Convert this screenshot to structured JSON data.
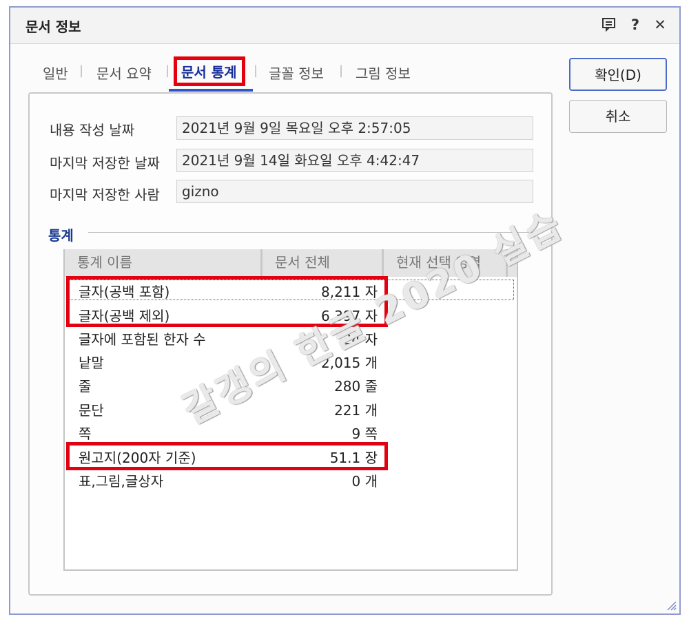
{
  "window": {
    "title": "문서 정보"
  },
  "titlebar_icons": [
    "comment-icon",
    "help-icon",
    "close-icon"
  ],
  "titlebar_glyphs": {
    "help": "?",
    "close": "✕"
  },
  "tabs": [
    {
      "label": "일반",
      "active": false
    },
    {
      "label": "문서 요약",
      "active": false
    },
    {
      "label": "문서 통계",
      "active": true
    },
    {
      "label": "글꼴 정보",
      "active": false
    },
    {
      "label": "그림 정보",
      "active": false
    }
  ],
  "separator": "|",
  "fields": [
    {
      "label": "내용 작성 날짜",
      "value": "2021년 9월 9일 목요일 오후 2:57:05"
    },
    {
      "label": "마지막 저장한 날짜",
      "value": "2021년 9월 14일 화요일 오후 4:42:47"
    },
    {
      "label": "마지막 저장한 사람",
      "value": "gizno"
    }
  ],
  "stats": {
    "section_title": "통계",
    "columns": [
      "통계 이름",
      "문서 전체",
      "현재 선택 영역"
    ],
    "rows": [
      {
        "name": "글자(공백 포함)",
        "value": "8,211 자"
      },
      {
        "name": "글자(공백 제외)",
        "value": "6,397 자"
      },
      {
        "name": "글자에 포함된 한자 수",
        "value": "24 자"
      },
      {
        "name": "낱말",
        "value": "2,015 개"
      },
      {
        "name": "줄",
        "value": "280 줄"
      },
      {
        "name": "문단",
        "value": "221 개"
      },
      {
        "name": "쪽",
        "value": "9 쪽"
      },
      {
        "name": "원고지(200자 기준)",
        "value": "51.1 장"
      },
      {
        "name": "표,그림,글상자",
        "value": "0 개"
      }
    ]
  },
  "buttons": {
    "ok": "확인(D)",
    "cancel": "취소"
  },
  "watermark": "갈갱의 한글 2020 실습",
  "colors": {
    "highlight": "#e3000f",
    "accent": "#2f55c9",
    "section": "#1a3a8f"
  }
}
